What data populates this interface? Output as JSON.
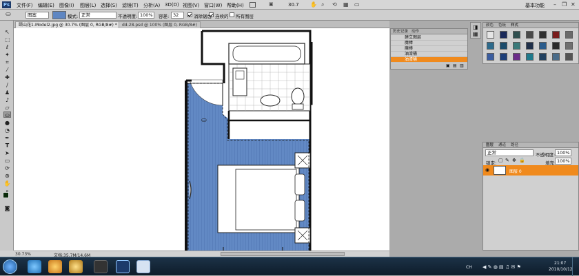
{
  "app": {
    "logo": "Ps",
    "workspace": "基本功能",
    "zoom_menu": "30.7"
  },
  "menu": [
    "文件(F)",
    "编辑(E)",
    "图像(I)",
    "图层(L)",
    "选择(S)",
    "滤镜(T)",
    "分析(A)",
    "3D(D)",
    "视图(V)",
    "窗口(W)",
    "帮助(H)"
  ],
  "options": {
    "sample_label": "图案",
    "mode_label": "模式:",
    "mode_value": "正常",
    "opacity_label": "不透明度:",
    "opacity_value": "100%",
    "tolerance_label": "容差:",
    "tolerance_value": "32",
    "antialias_label": "消除锯齿",
    "contiguous_label": "连续的",
    "all_layers_label": "所有图层"
  },
  "tabs": [
    {
      "label": "颐山花1-Model2.jpg @ 30.7% (图层 0, RGB/8#) *"
    },
    {
      "label": "dd-28.psd @ 100% (图层 0, RGB/8#)"
    }
  ],
  "status": {
    "zoom": "30.73%",
    "doc": "文档:35.7M/14.6M"
  },
  "history": {
    "tabs": [
      "历史记录",
      "动作"
    ],
    "items": [
      "建立图层",
      "魔棒",
      "魔棒",
      "油漆桶",
      "油漆桶"
    ],
    "selected_index": 4
  },
  "styles_panel": {
    "tabs": [
      "颜色",
      "色板",
      "样式"
    ],
    "swatch_colors": [
      "#e6e6e6",
      "#1a2a5a",
      "#2f4f4f",
      "#4a4a4a",
      "#303030",
      "#7a1c1c",
      "#6a6a6a",
      "#2d6a8c",
      "#1b4b6b",
      "#3a7a7a",
      "#20304a",
      "#2b5c8c",
      "#2a2a2a",
      "#707070",
      "#3b5da0",
      "#1d3f7a",
      "#6b2c8a",
      "#1f7a8c",
      "#204060",
      "#4a6c8a",
      "#555555"
    ]
  },
  "layers": {
    "tabs": [
      "图层",
      "通道",
      "路径"
    ],
    "blend_mode": "正常",
    "opacity_label": "不透明度:",
    "opacity_value": "100%",
    "lock_label": "锁定:",
    "fill_label": "填充:",
    "fill_value": "100%",
    "layer_name": "图层 0"
  },
  "taskbar": {
    "lang": "CH",
    "time": "21:07",
    "date": "2010/10/12"
  },
  "colors": {
    "accent": "#f08a1d",
    "fill_blue": "#5e86c2"
  }
}
